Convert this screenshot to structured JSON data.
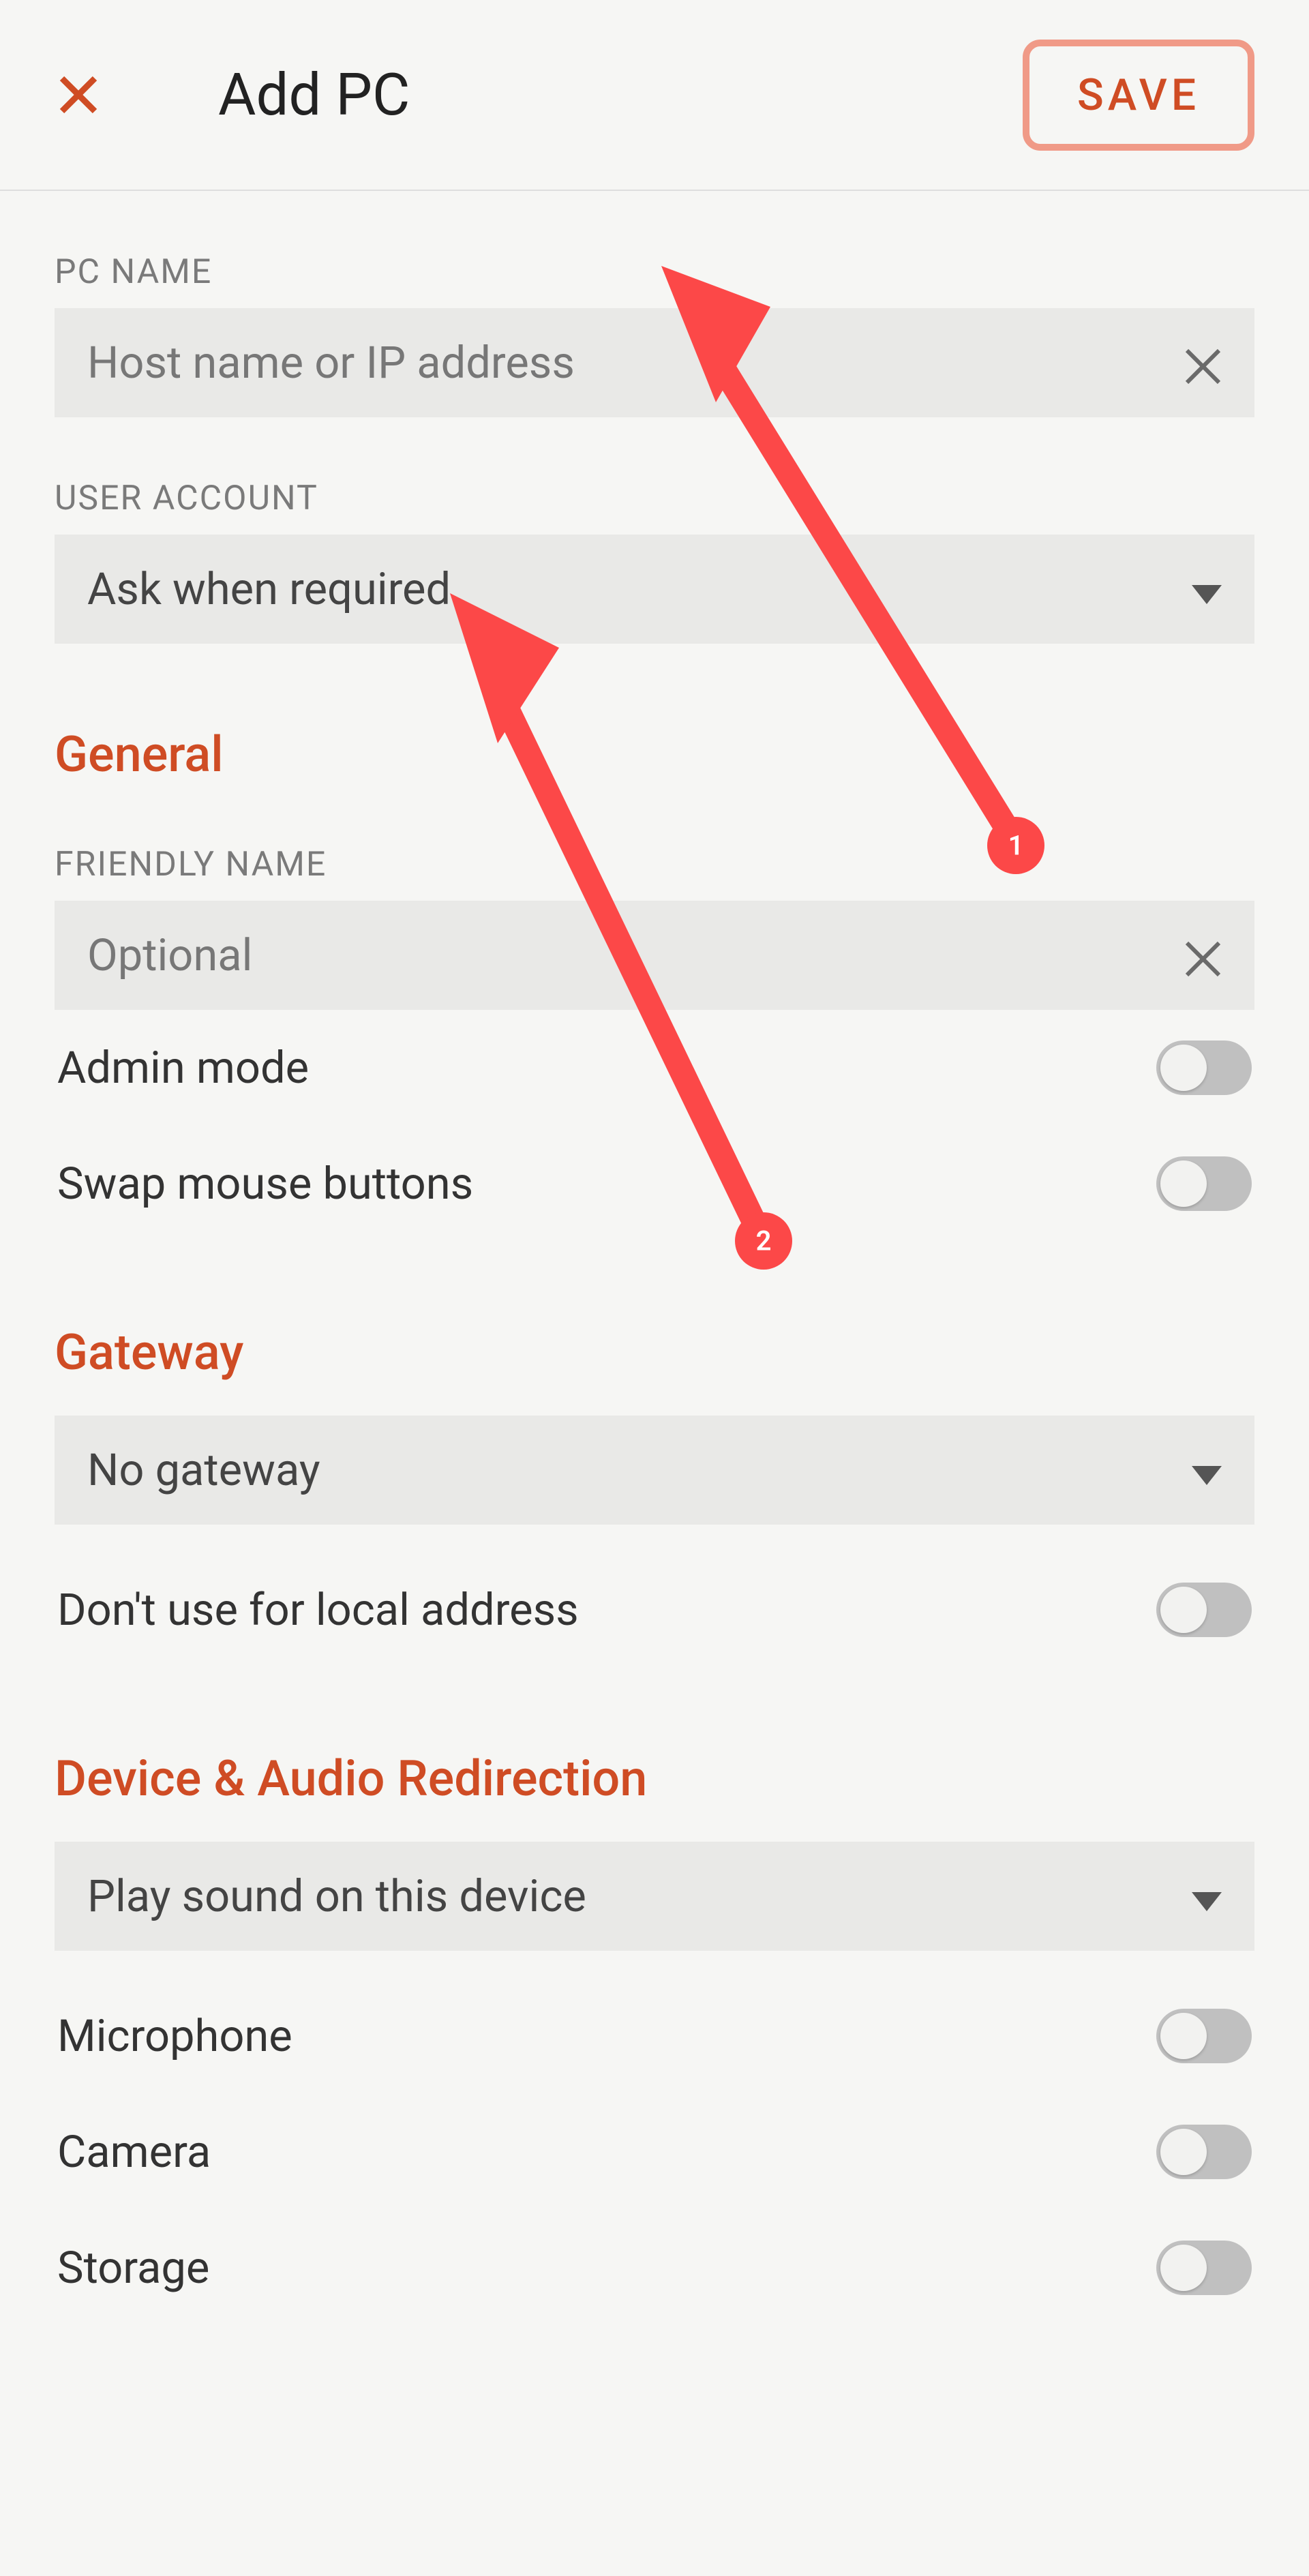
{
  "header": {
    "title": "Add PC",
    "save_label": "SAVE"
  },
  "pc_name": {
    "label": "PC NAME",
    "placeholder": "Host name or IP address"
  },
  "user_account": {
    "label": "USER ACCOUNT",
    "value": "Ask when required"
  },
  "sections": {
    "general": "General",
    "gateway": "Gateway",
    "device_audio": "Device & Audio Redirection"
  },
  "friendly_name": {
    "label": "FRIENDLY NAME",
    "placeholder": "Optional"
  },
  "toggles": {
    "admin_mode": "Admin mode",
    "swap_mouse": "Swap mouse buttons",
    "dont_use_local": "Don't use for local address",
    "microphone": "Microphone",
    "camera": "Camera",
    "storage": "Storage"
  },
  "gateway_select": "No gateway",
  "audio_select": "Play sound on this device",
  "annotations": {
    "a1": "1",
    "a2": "2"
  }
}
